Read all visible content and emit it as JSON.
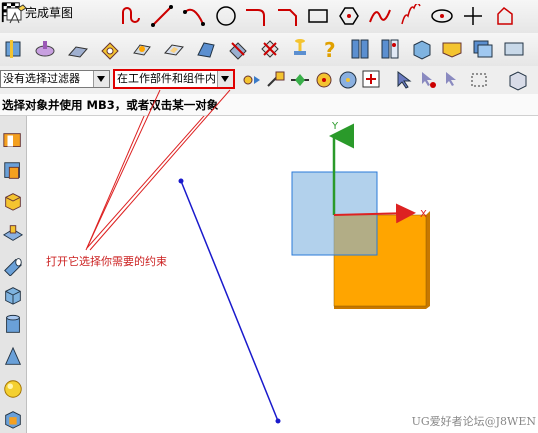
{
  "toolbar1": {
    "finish_sketch_label": "完成草图",
    "tools": [
      "sketch-icon",
      "profile-icon",
      "line-icon",
      "arc-icon",
      "circle-icon",
      "fillet-icon",
      "chamfer-icon",
      "rectangle-icon",
      "polygon-icon",
      "studio-spline-icon",
      "spring-icon",
      "ellipse-icon",
      "point-icon",
      "offset-icon"
    ]
  },
  "toolbar2": {
    "tools": [
      "extrude-icon",
      "revolve-icon",
      "sweep-icon",
      "hole-icon",
      "boss-icon",
      "pocket-icon",
      "pad-icon",
      "trim-body-icon",
      "blend-icon",
      "thread-icon",
      "help-icon",
      "book-icon",
      "book-open-icon",
      "box-icon",
      "feature-icon",
      "layer-icon"
    ]
  },
  "selection_bar": {
    "filter_value": "没有选择过滤器",
    "scope_value": "在工作部件和组件内",
    "scope_highlight_color": "#e00000"
  },
  "status_prompt": "选择对象并使用 MB3，或者双击某一对象",
  "sidebar": {
    "items": [
      "insert-feature-icon",
      "extract-icon",
      "block-icon",
      "plane-icon",
      "cylinder-icon",
      "cube-icon",
      "drum-icon",
      "cone-icon",
      "sphere-icon",
      "face-icon"
    ]
  },
  "canvas": {
    "annotation": "打开它选择你需要的约束",
    "watermark": "UG爱好者论坛@J8WEN",
    "axis_y_label": "Y",
    "axis_x_label": "X",
    "colors": {
      "line": "#1a1acc",
      "box": "#ffa500",
      "plane": "#7fb3e0",
      "y_axis": "#2a9a2a",
      "x_axis": "#dd2222",
      "arrow": "#dd2222"
    }
  }
}
